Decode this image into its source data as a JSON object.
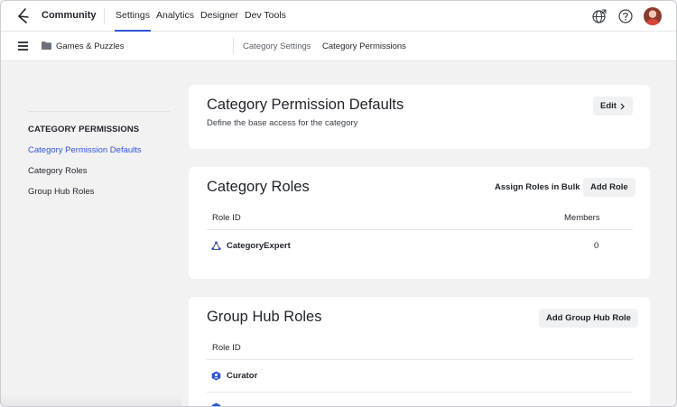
{
  "topnav": {
    "brand": "Community",
    "tabs": [
      {
        "label": "Settings",
        "active": true
      },
      {
        "label": "Analytics",
        "active": false
      },
      {
        "label": "Designer",
        "active": false
      },
      {
        "label": "Dev Tools",
        "active": false
      }
    ],
    "icons": [
      "globe-icon",
      "help-icon",
      "user-avatar"
    ]
  },
  "subnav": {
    "menu_icon": "hamburger-icon",
    "folder_icon": "folder-icon",
    "category": "Games & Puzzles",
    "links": [
      "Category Settings",
      "Category Permissions"
    ]
  },
  "sidebar": {
    "heading": "CATEGORY PERMISSIONS",
    "items": [
      {
        "label": "Category Permission Defaults",
        "active": true
      },
      {
        "label": "Category Roles",
        "active": false
      },
      {
        "label": "Group Hub Roles",
        "active": false
      }
    ]
  },
  "defaults_card": {
    "title": "Category Permission Defaults",
    "description": "Define the base access for the category",
    "edit_label": "Edit"
  },
  "roles_card": {
    "title": "Category Roles",
    "bulk_label": "Assign Roles in Bulk",
    "add_label": "Add Role",
    "columns": [
      "Role ID",
      "Members"
    ],
    "rows": [
      {
        "role": "CategoryExpert",
        "members": "0",
        "icon": "expert-icon"
      }
    ]
  },
  "grouphub_card": {
    "title": "Group Hub Roles",
    "add_label": "Add Group Hub Role",
    "columns": [
      "Role ID"
    ],
    "rows": [
      {
        "role": "Curator",
        "icon": "curator-icon"
      }
    ]
  },
  "colors": {
    "accent": "#2f54d9",
    "background": "#f2f2f3",
    "card": "#ffffff"
  }
}
